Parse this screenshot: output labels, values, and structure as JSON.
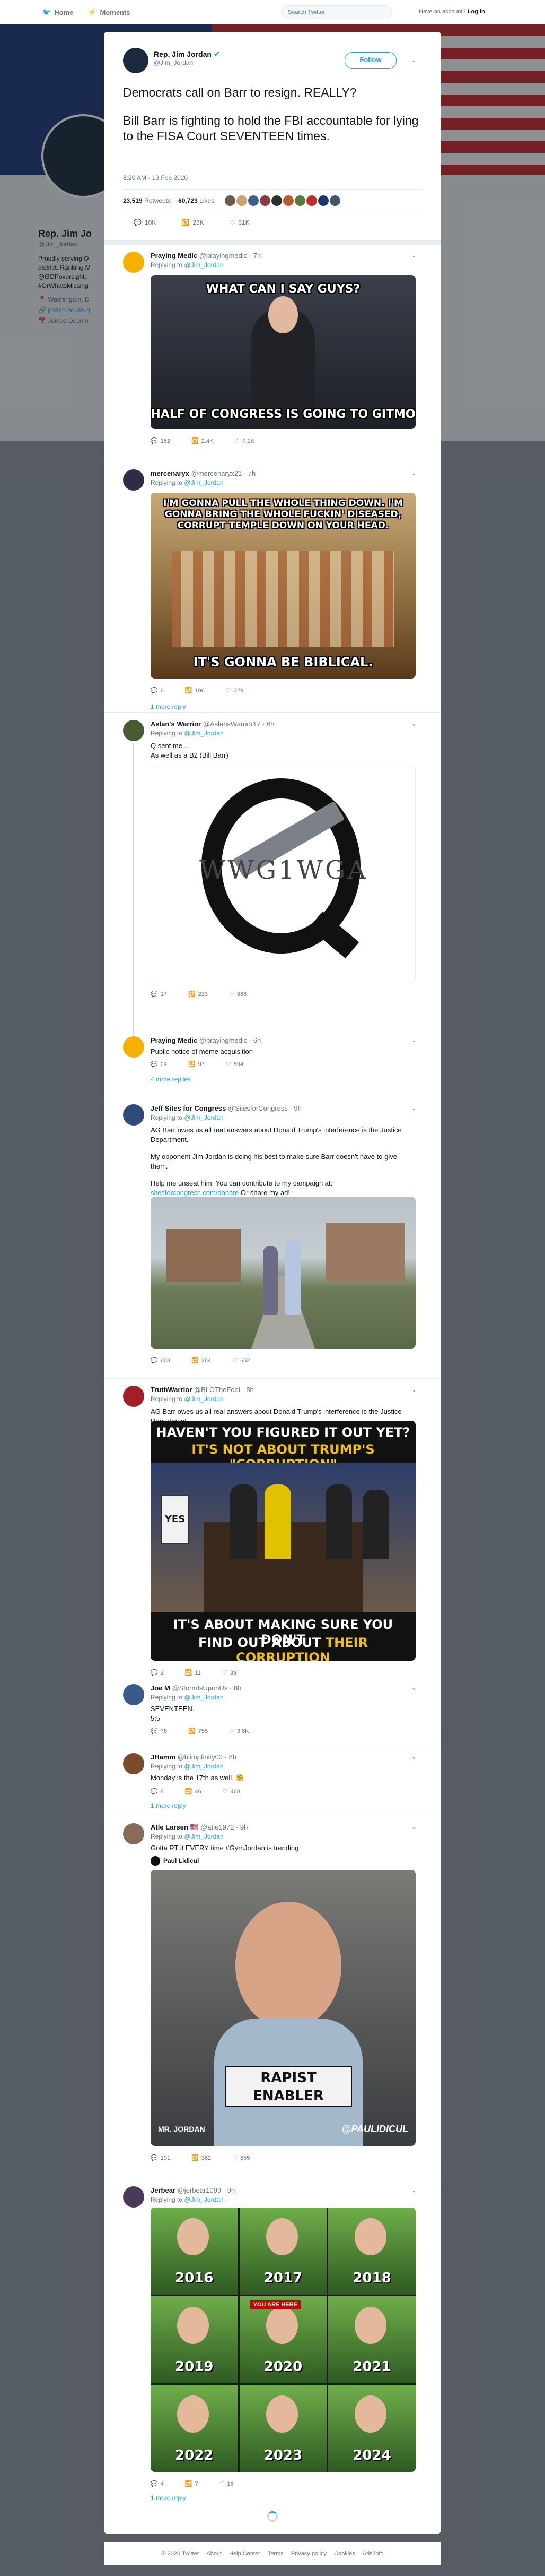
{
  "topbar": {
    "home": "Home",
    "moments": "Moments",
    "search_placeholder": "Search Twitter",
    "account_prompt": "Have an account?",
    "login": "Log in"
  },
  "background_profile": {
    "name": "Rep. Jim Jo",
    "handle": "@Jim_Jordan",
    "bio": "Proudly serving O\ndistrict. Ranking M\n@GOPoversight.\n#OrWhatsMissing",
    "location": "Washington, D",
    "link": "jordan.house.g",
    "joined": "Joined Decem"
  },
  "tweet": {
    "name": "Rep. Jim Jordan",
    "handle": "@Jim_Jordan",
    "follow_label": "Follow",
    "paragraph1": "Democrats call on Barr to resign. REALLY?",
    "paragraph2": "Bill Barr is fighting to hold the FBI accountable for lying to the FISA Court SEVENTEEN times.",
    "timestamp": "8:20 AM - 13 Feb 2020",
    "retweets": "23,519",
    "retweets_label": "Retweets",
    "likes": "60,723",
    "likes_label": "Likes",
    "replies_count": "10K",
    "retweet_count": "23K",
    "like_count": "61K"
  },
  "replies": [
    {
      "name": "Praying Medic",
      "handle": "@prayingmedic · 7h",
      "replying": "Replying to",
      "to": "@Jim_Jordan",
      "caption_top": "WHAT CAN I SAY GUYS?",
      "caption_bottom": "HALF OF CONGRESS IS GOING TO GITMO",
      "c": "152",
      "r": "2.4K",
      "l": "7.1K"
    },
    {
      "name": "mercenaryx",
      "handle": "@mercenaryx21 · 7h",
      "replying": "Replying to",
      "to": "@Jim_Jordan",
      "caption_top": "I'M GONNA PULL THE WHOLE THING DOWN. I'M GONNA BRING THE WHOLE FUCKIN' DISEASED, CORRUPT TEMPLE DOWN ON YOUR HEAD.",
      "caption_bottom": "IT'S GONNA BE BIBLICAL.",
      "c": "6",
      "r": "106",
      "l": "329",
      "more": "1 more reply"
    },
    {
      "name": "Aslan's Warrior",
      "handle": "@AslansWarrior17 · 6h",
      "replying": "Replying to",
      "to": "@Jim_Jordan",
      "text": "Q sent me...\nAs well as a B2 (Bill Barr)",
      "image_text": "WWG1WGA",
      "c": "17",
      "r": "213",
      "l": "986"
    },
    {
      "name": "Praying Medic",
      "handle": "@prayingmedic · 6h",
      "text": "Public notice of meme acquisition",
      "c": "24",
      "r": "97",
      "l": "894",
      "more": "4 more replies"
    },
    {
      "name": "Jeff Sites for Congress",
      "handle": "@SitesforCongress · 9h",
      "replying": "Replying to",
      "to": "@Jim_Jordan",
      "text1": "AG Barr owes us all real answers about Donald Trump's interference is the Justice Department.",
      "text2": "My opponent Jim Jordan is doing his best to make sure Barr doesn't have to give them.",
      "text3": "Help me unseat him. You can contribute to my campaign at:",
      "link": "sitesforcongress.com/donate",
      "text4": "Or share my ad!",
      "c": "803",
      "r": "284",
      "l": "652"
    },
    {
      "name": "TruthWarrior",
      "handle": "@BLOTheFool · 8h",
      "replying": "Replying to",
      "to": "@Jim_Jordan",
      "text": "AG Barr owes us all real answers about Donald Trump's interference is the Justice Department.",
      "caption_top1": "HAVEN'T YOU FIGURED IT OUT YET?",
      "caption_top2": "IT'S NOT ABOUT TRUMP'S \"CORRUPTION\"",
      "caption_bottom1": "IT'S ABOUT MAKING SURE YOU DON'T",
      "caption_bottom2": "FIND OUT ABOUT",
      "caption_bottom3": "THEIR CORRUPTION",
      "sign": "YES",
      "c": "2",
      "r": "11",
      "l": "39"
    },
    {
      "name": "Joe M",
      "handle": "@StormIsUponUs · 8h",
      "replying": "Replying to",
      "to": "@Jim_Jordan",
      "text": "SEVENTEEN.\n5:5",
      "c": "78",
      "r": "755",
      "l": "3.8K"
    },
    {
      "name": "JHamm",
      "handle": "@blimpfinity03 · 8h",
      "replying": "Replying to",
      "to": "@Jim_Jordan",
      "text": "Monday is the 17th as well. 🧐",
      "c": "8",
      "r": "46",
      "l": "468",
      "more": "1 more reply"
    },
    {
      "name": "Atle Larsen 🇺🇸",
      "handle": "@atle1972 · 9h",
      "replying": "Replying to",
      "to": "@Jim_Jordan",
      "text": "Gotta RT it EVERY time #GymJordan is trending",
      "hashtag": "#GymJordan",
      "quoted": "Paul Lidicul",
      "caption_tag": "RAPIST ENABLER",
      "caption_name": "MR. JORDAN",
      "caption_wm": "@PAULIDICUL",
      "c": "191",
      "r": "362",
      "l": "855"
    },
    {
      "name": "Jerbear",
      "handle": "@jerbear1099 · 9h",
      "replying": "Replying to",
      "to": "@Jim_Jordan",
      "years": [
        "2016",
        "2017",
        "2018",
        "2019",
        "2020",
        "2021",
        "2022",
        "2023",
        "2024"
      ],
      "you_are_here": "YOU ARE HERE",
      "c": "4",
      "r": "7",
      "l": "16",
      "more": "1 more reply"
    }
  ],
  "footer": [
    "© 2020 Twitter",
    "About",
    "Help Center",
    "Terms",
    "Privacy policy",
    "Cookies",
    "Ads info"
  ]
}
